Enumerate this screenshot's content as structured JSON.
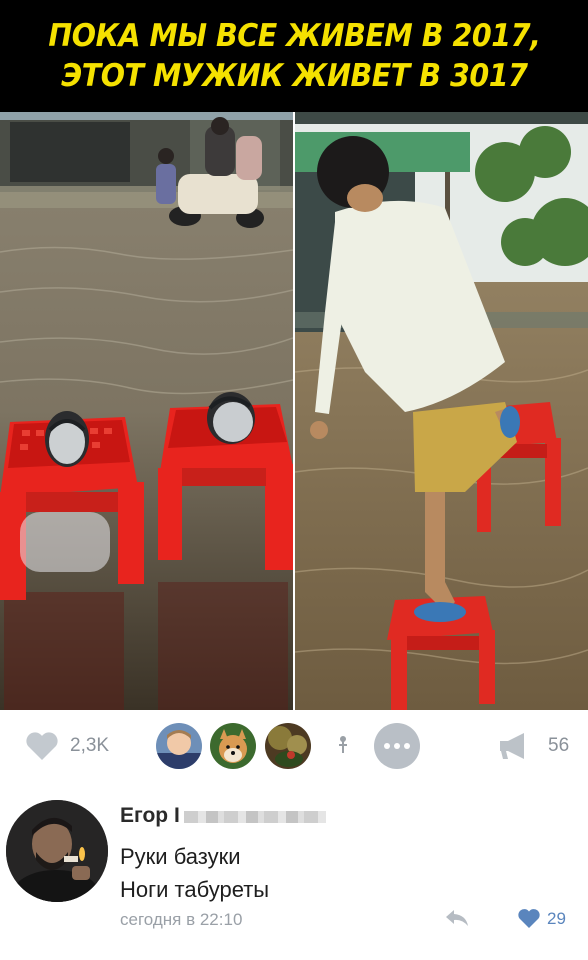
{
  "meme": {
    "caption_line1": "ПОКА МЫ ВСЕ ЖИВЕМ В 2017,",
    "caption_line2": "ЭТОТ МУЖИК ЖИВЕТ В 3017"
  },
  "post_actions": {
    "likes": "2,3K",
    "shares": "56"
  },
  "comment": {
    "author": "Егор І",
    "line1": "Руки базуки",
    "line2": "Ноги табуреты",
    "timestamp": "сегодня в 22:10",
    "likes": "29"
  },
  "icons": {
    "like": "heart-icon",
    "more": "more-dots-icon",
    "share": "megaphone-icon",
    "reply": "reply-arrow-icon",
    "comment_like": "heart-icon",
    "pin": "pin-icon"
  },
  "colors": {
    "caption_text": "#f5e100",
    "caption_bg": "#000000",
    "icon_gray": "#b9bfc6",
    "liked_blue": "#5a85bd"
  }
}
